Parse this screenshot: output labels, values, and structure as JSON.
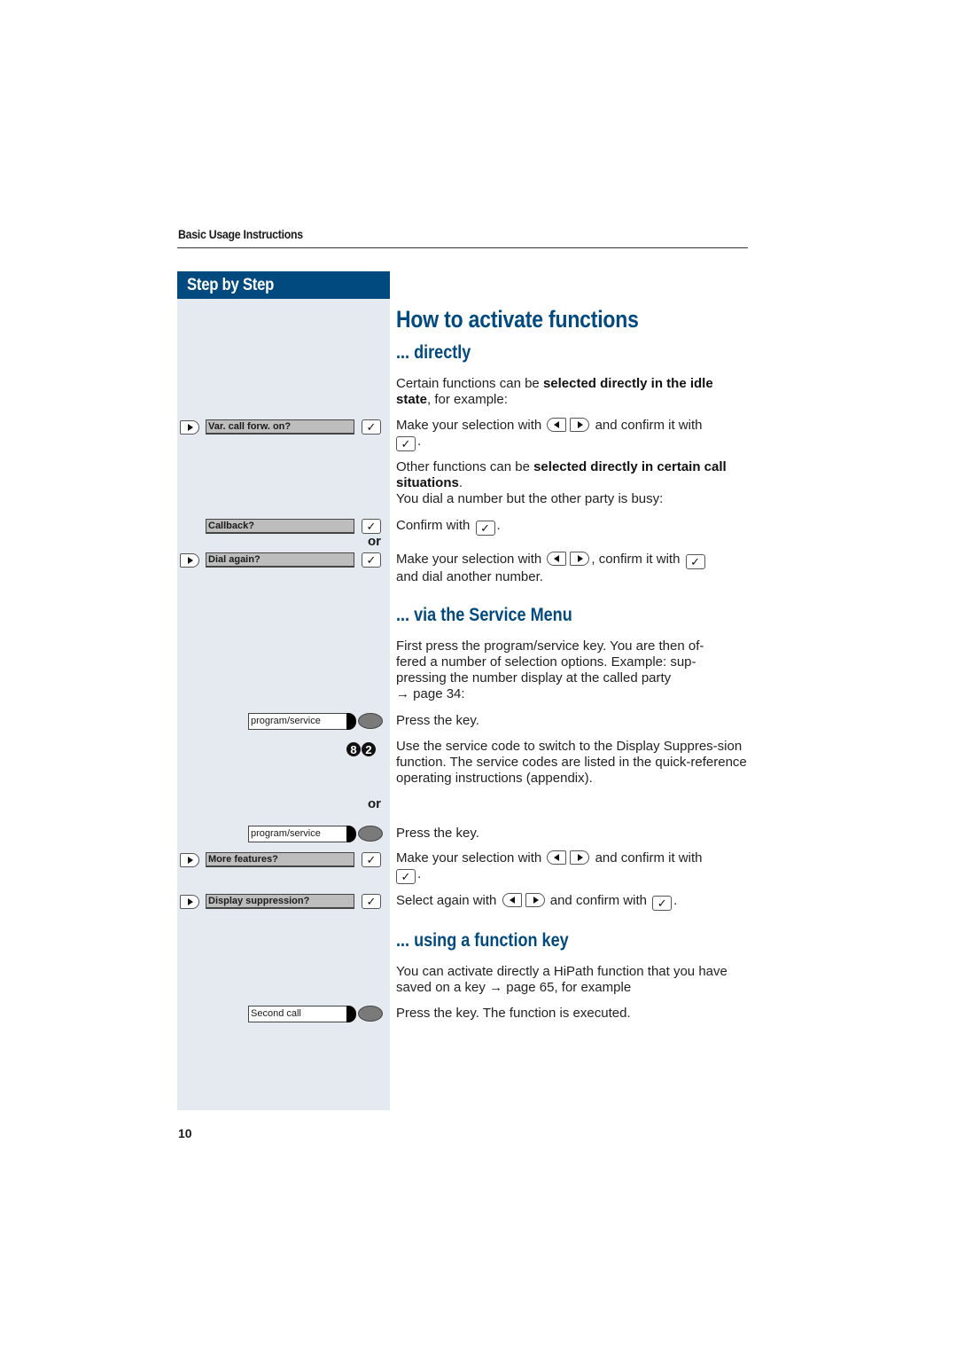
{
  "header": {
    "section_title": "Basic Usage Instructions"
  },
  "sidebar": {
    "title": "Step by Step",
    "displays": {
      "var_call_forw": "Var. call forw. on?",
      "callback": "Callback?",
      "dial_again": "Dial again?",
      "more_features": "More features?",
      "display_suppression": "Display suppression?"
    },
    "function_keys": {
      "program_service_1": "program/service",
      "program_service_2": "program/service",
      "second_call": "Second call"
    },
    "or_1": "or",
    "or_2": "or",
    "digits": [
      "8",
      "2"
    ]
  },
  "main": {
    "title": "How to activate functions",
    "directly": {
      "heading": "... directly",
      "intro_pre": "Certain functions can be ",
      "intro_bold": "selected directly in the idle state",
      "intro_post": ", for example:",
      "step1_pre": "Make your selection with",
      "step1_mid": "and confirm it with",
      "step1_post": ".",
      "other_pre": "Other functions can be ",
      "other_bold": "selected directly in certain call situations",
      "other_post": ".",
      "busy": "You dial a number but the other party is busy:",
      "confirm_pre": "Confirm with",
      "confirm_post": ".",
      "step3_pre": "Make your selection with",
      "step3_mid": ", confirm it with",
      "step3_post": "and dial another number."
    },
    "service_menu": {
      "heading": "... via the Service Menu",
      "intro": "First press the program/service key. You are then of-fered a number of selection options. Example: sup-pressing the number display at the called party",
      "intro_line1": "First press the program/service key. You are then of-",
      "intro_line2": "fered a number of selection options. Example: sup-",
      "intro_line3": "pressing the number display at the called party",
      "page_ref": "→ page 34:",
      "press_key_1": "Press the key.",
      "service_code": "Use the service code to switch to the Display Suppres-sion function. The service codes are listed in the quick-reference operating instructions (appendix).",
      "press_key_2": "Press the key.",
      "step_pre": "Make your selection with",
      "step_mid": "and confirm it with",
      "step_post": ".",
      "select_pre": "Select again with",
      "select_mid": "and confirm with",
      "select_post": "."
    },
    "function_key": {
      "heading": "... using a function key",
      "intro": "You can activate directly a HiPath function that you have saved on a key → page 65, for example",
      "press": "Press the key. The function is executed."
    }
  },
  "footer": {
    "page_number": "10"
  },
  "colors": {
    "accent": "#004a7f",
    "sidebar_bg": "#e4eaf0",
    "display_bg": "#bdbdbd"
  }
}
